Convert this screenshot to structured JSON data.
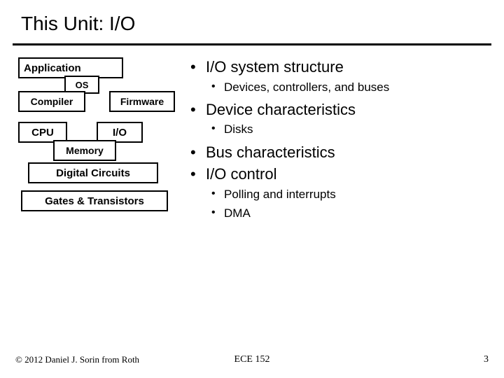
{
  "title": "This Unit: I/O",
  "diagram": {
    "application": "Application",
    "os": "OS",
    "compiler": "Compiler",
    "firmware": "Firmware",
    "cpu": "CPU",
    "io": "I/O",
    "memory": "Memory",
    "digital": "Digital Circuits",
    "gates": "Gates & Transistors"
  },
  "bullets": {
    "b1": "I/O system structure",
    "b1a": "Devices, controllers, and buses",
    "b2": "Device characteristics",
    "b2a": "Disks",
    "b3": "Bus characteristics",
    "b4": "I/O control",
    "b4a": "Polling and interrupts",
    "b4b": "DMA"
  },
  "footer": {
    "copyright": "© 2012 Daniel J. Sorin from Roth",
    "course": "ECE 152",
    "page": "3"
  }
}
